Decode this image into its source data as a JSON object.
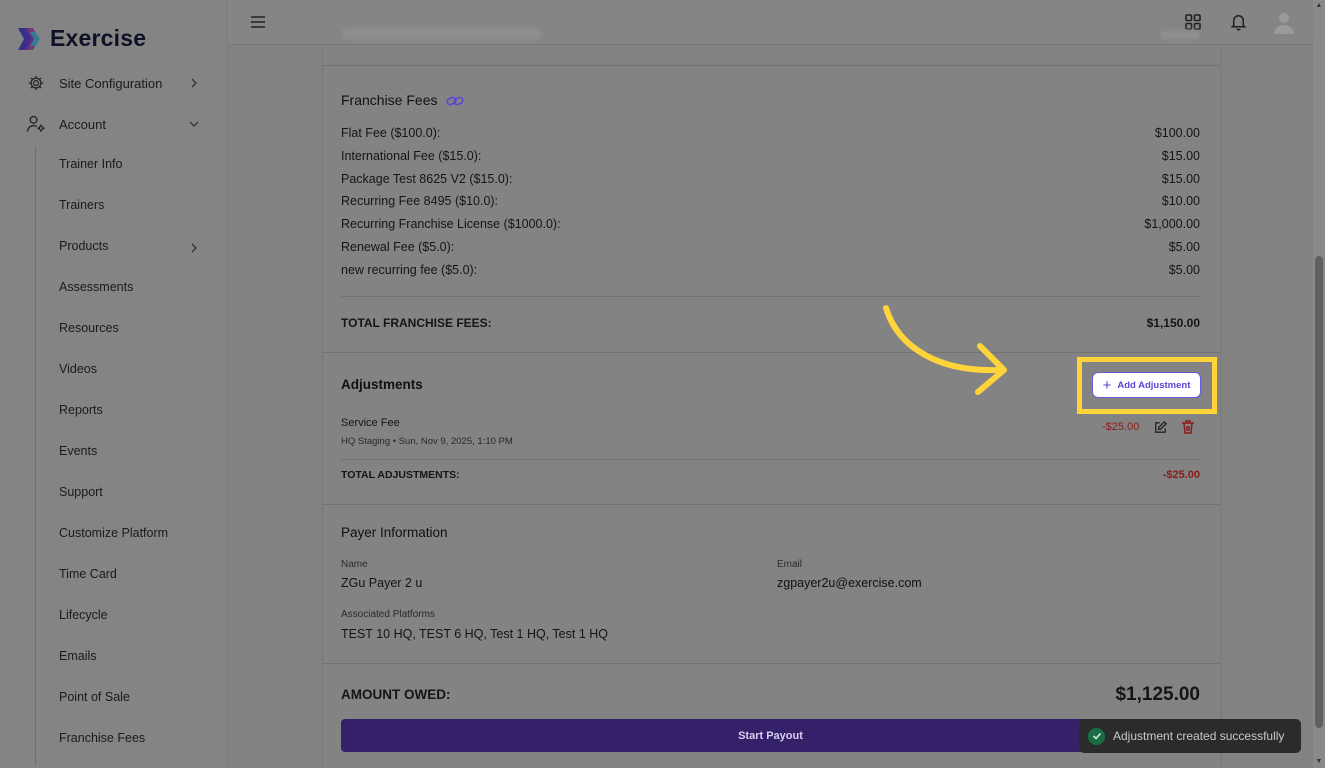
{
  "app": {
    "name": "Exercise"
  },
  "sidebar": {
    "top_items": [
      {
        "label": "Site Configuration",
        "icon": "gear-icon"
      },
      {
        "label": "Account",
        "icon": "user-gear-icon"
      }
    ],
    "sub_items": [
      "Trainer Info",
      "Trainers",
      "Products",
      "Assessments",
      "Resources",
      "Videos",
      "Reports",
      "Events",
      "Support",
      "Customize Platform",
      "Time Card",
      "Lifecycle",
      "Emails",
      "Point of Sale",
      "Franchise Fees"
    ]
  },
  "franchise_fees": {
    "title": "Franchise Fees",
    "rows": [
      {
        "label": "Flat Fee ($100.0):",
        "value": "$100.00"
      },
      {
        "label": "International Fee ($15.0):",
        "value": "$15.00"
      },
      {
        "label": "Package Test 8625 V2 ($15.0):",
        "value": "$15.00"
      },
      {
        "label": "Recurring Fee 8495 ($10.0):",
        "value": "$10.00"
      },
      {
        "label": "Recurring Franchise License ($1000.0):",
        "value": "$1,000.00"
      },
      {
        "label": "Renewal Fee ($5.0):",
        "value": "$5.00"
      },
      {
        "label": "new recurring fee ($5.0):",
        "value": "$5.00"
      }
    ],
    "total_label": "TOTAL FRANCHISE FEES:",
    "total_value": "$1,150.00"
  },
  "adjustments": {
    "title": "Adjustments",
    "add_button": "Add Adjustment",
    "item": {
      "name": "Service Fee",
      "meta": "HQ Staging • Sun, Nov 9, 2025, 1:10 PM",
      "amount": "-$25.00"
    },
    "total_label": "TOTAL ADJUSTMENTS:",
    "total_value": "-$25.00"
  },
  "payer": {
    "title": "Payer Information",
    "name_label": "Name",
    "name_value": "ZGu Payer 2 u",
    "email_label": "Email",
    "email_value": "zgpayer2u@exercise.com",
    "platforms_label": "Associated Platforms",
    "platforms_value": "TEST 10 HQ, TEST 6 HQ, Test 1 HQ, Test 1 HQ"
  },
  "amount_owed": {
    "label": "AMOUNT OWED:",
    "value": "$1,125.00"
  },
  "payout_button": "Start Payout",
  "toast": "Adjustment created successfully",
  "colors": {
    "highlight": "#ffd43b",
    "accent": "#5a46d6",
    "negative": "#8a1b1b"
  }
}
